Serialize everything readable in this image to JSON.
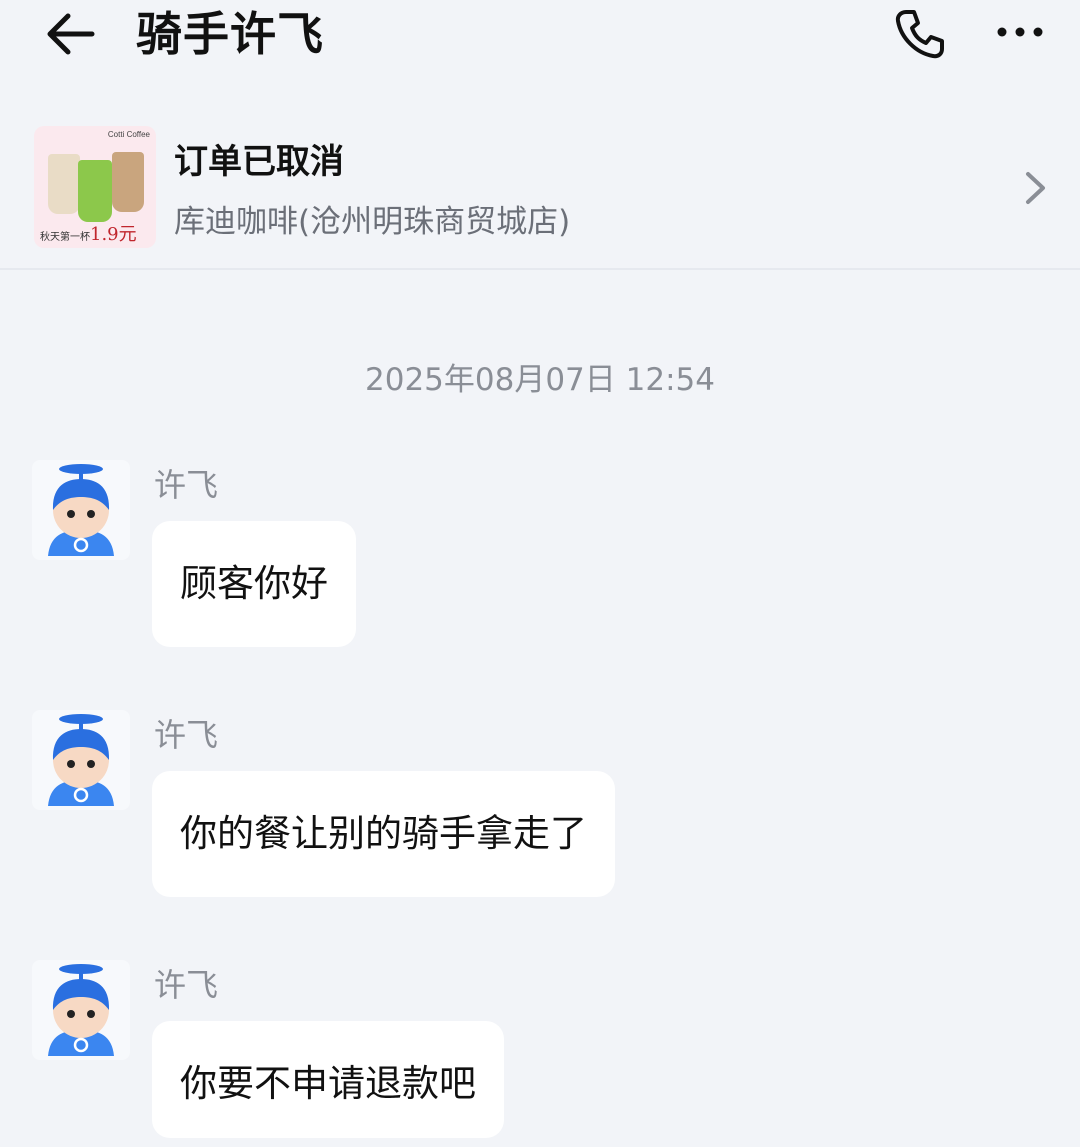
{
  "header": {
    "title": "骑手许飞",
    "back_icon": "arrow-left-icon",
    "call_icon": "phone-icon",
    "more_icon": "more-dots-icon"
  },
  "order": {
    "status": "订单已取消",
    "store": "库迪咖啡(沧州明珠商贸城店)",
    "thumbnail": {
      "brand": "Cotti Coffee",
      "promo_text": "秋天第一杯",
      "promo_price": "1.9元"
    },
    "chevron_icon": "chevron-right-icon"
  },
  "chat": {
    "timestamp": "2025年08月07日 12:54",
    "messages": [
      {
        "sender": "许飞",
        "text": "顾客你好"
      },
      {
        "sender": "许飞",
        "text": "你的餐让别的骑手拿走了"
      },
      {
        "sender": "许飞",
        "text": "你要不申请退款吧"
      }
    ]
  },
  "colors": {
    "background": "#f2f4f8",
    "bubble": "#ffffff",
    "avatar_blue": "#2a6fe0",
    "muted_text": "#8a8e96"
  }
}
